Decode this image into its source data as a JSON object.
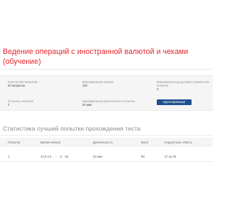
{
  "course": {
    "title": "Ведение операций с иностранной валютой и чеками (обучение)"
  },
  "info": {
    "questions_label": "Количество вопросов",
    "questions_value": "30 вопросов",
    "max_score_label": "Максимальная оценка",
    "max_score_value": "100",
    "max_attempts_label": "Максимально допустимое количество попыток",
    "max_attempts_value": "3",
    "remaining_label": "Осталось попыток",
    "remaining_value": "2",
    "max_duration_label": "Максимальная длительность попытки",
    "max_duration_value": "40 мин.",
    "identify_button": "Идентификация"
  },
  "stats": {
    "title": "Статистика лучшей попытки прохождения теста",
    "columns": [
      "Попытки",
      "Время начала",
      "Длительность",
      "Балл",
      "Корректные ответы"
    ],
    "rows": [
      [
        "1",
        "12.0 3.2 .   :    0   :34",
        "23 мин",
        "90",
        "27 из 30"
      ]
    ]
  }
}
